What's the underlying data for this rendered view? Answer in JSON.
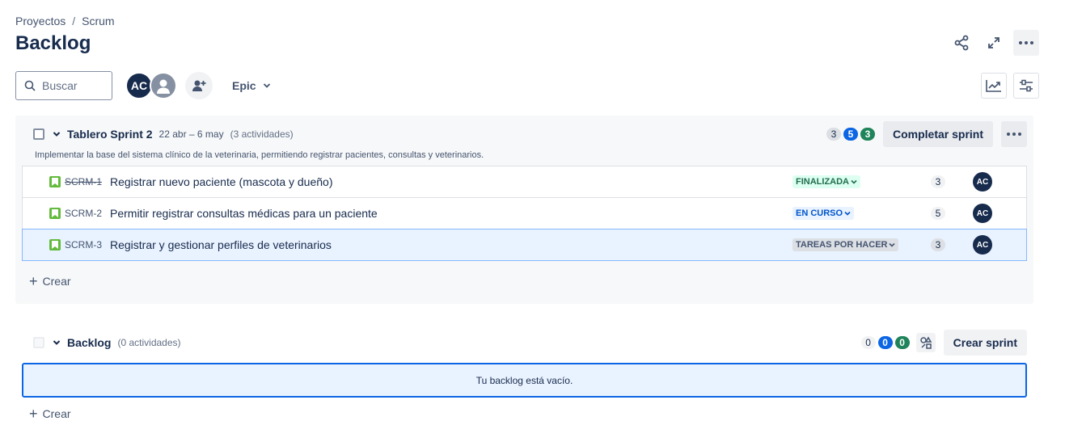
{
  "breadcrumb": {
    "root": "Proyectos",
    "separator": "/",
    "project": "Scrum"
  },
  "page": {
    "title": "Backlog"
  },
  "toolbar": {
    "search_placeholder": "Buscar",
    "avatar_initials": "AC",
    "epic_label": "Epic"
  },
  "sprint": {
    "name": "Tablero Sprint 2",
    "dates": "22 abr – 6 may",
    "activity_count": "(3 actividades)",
    "goal": "Implementar la base del sistema clínico de la veterinaria, permitiendo registrar pacientes, consultas y veterinarios.",
    "counts": {
      "todo": "3",
      "in_progress": "5",
      "done": "3"
    },
    "complete_label": "Completar sprint",
    "issues": [
      {
        "key": "SCRM-1",
        "summary": "Registrar nuevo paciente (mascota y dueño)",
        "status": "FINALIZADA",
        "points": "3",
        "assignee": "AC"
      },
      {
        "key": "SCRM-2",
        "summary": "Permitir registrar consultas médicas para un paciente",
        "status": "EN CURSO",
        "points": "5",
        "assignee": "AC"
      },
      {
        "key": "SCRM-3",
        "summary": "Registrar y gestionar perfiles de veterinarios",
        "status": "TAREAS POR HACER",
        "points": "3",
        "assignee": "AC"
      }
    ],
    "create_label": "Crear"
  },
  "backlog": {
    "name": "Backlog",
    "activity_count": "(0 actividades)",
    "counts": {
      "todo": "0",
      "in_progress": "0",
      "done": "0"
    },
    "create_sprint_label": "Crear sprint",
    "empty_message": "Tu backlog está vacío.",
    "create_label": "Crear"
  },
  "colors": {
    "primary": "#0c66e4",
    "done_green": "#1f845a",
    "story_green": "#63ba3c",
    "text_dark": "#172b4d"
  }
}
